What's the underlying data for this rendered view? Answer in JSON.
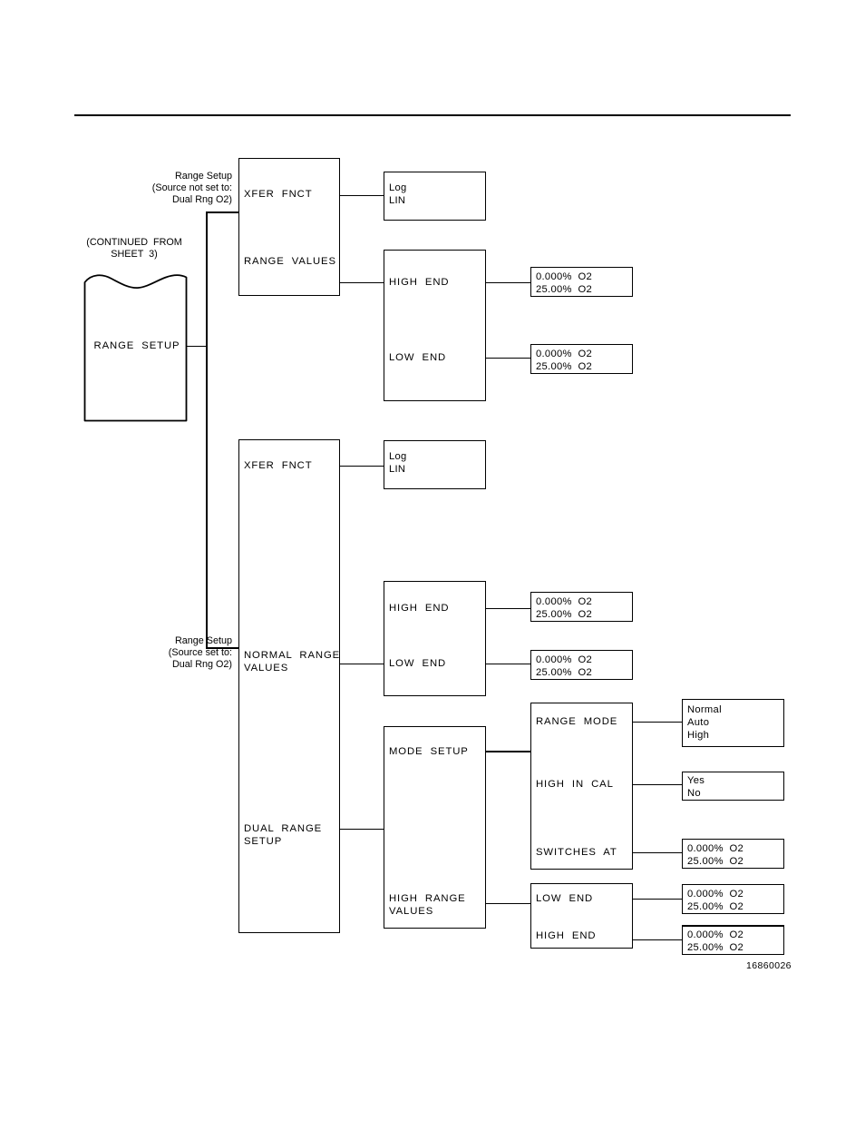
{
  "document": {
    "drawing_number": "16860026",
    "continued_from": "(CONTINUED  FROM\nSHEET  3)"
  },
  "annotations": {
    "top_branch_note": "Range Setup\n(Source not set to:\nDual Rng O2)",
    "bottom_branch_note": "Range Setup\n(Source set to:\nDual Rng O2)"
  },
  "root": {
    "label": "RANGE  SETUP"
  },
  "branch_normal": {
    "menu": {
      "item_1": "XFER  FNCT",
      "item_2": "RANGE  VALUES"
    },
    "xfer_options": "Log\nLIN",
    "range_values_menu": {
      "item_1": "HIGH  END",
      "item_2": "LOW  END"
    },
    "high_end_values": "0.000%  O2\n25.00%  O2",
    "low_end_values": "0.000%  O2\n25.00%  O2"
  },
  "branch_dual": {
    "menu": {
      "item_1": "XFER  FNCT",
      "item_2": "NORMAL  RANGE\nVALUES",
      "item_3": "DUAL  RANGE\nSETUP"
    },
    "xfer_options": "Log\nLIN",
    "normal_range_menu": {
      "item_1": "HIGH  END",
      "item_2": "LOW  END"
    },
    "normal_high_end_values": "0.000%  O2\n25.00%  O2",
    "normal_low_end_values": "0.000%  O2\n25.00%  O2",
    "dual_range_menu": {
      "item_1": "MODE  SETUP",
      "item_2": "HIGH  RANGE\nVALUES"
    },
    "mode_setup_menu": {
      "item_1": "RANGE  MODE",
      "item_2": "HIGH  IN  CAL",
      "item_3": "SWITCHES  AT"
    },
    "range_mode_options": "Normal\nAuto\nHigh",
    "high_in_cal_options": "Yes\nNo",
    "switches_at_values": "0.000%  O2\n25.00%  O2",
    "high_range_menu": {
      "item_1": "LOW  END",
      "item_2": "HIGH  END"
    },
    "high_range_low_end_values": "0.000%  O2\n25.00%  O2",
    "high_range_high_end_values": "0.000%  O2\n25.00%  O2"
  },
  "colors": {
    "ink": "#000000",
    "paper": "#ffffff"
  }
}
